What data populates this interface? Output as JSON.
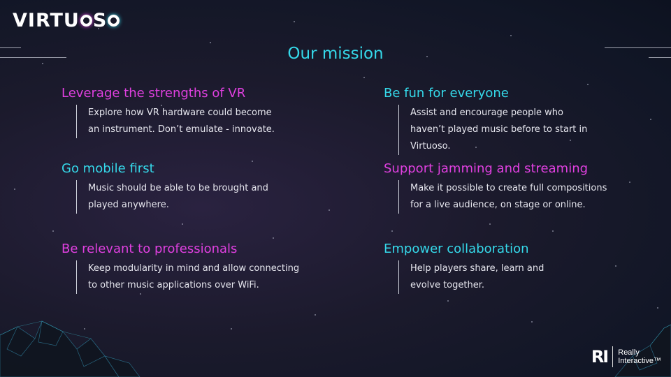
{
  "logo": {
    "part1": "VIRTU",
    "part2": "S",
    "ring1_color": "#e040e0",
    "ring2_color": "#35d9ea"
  },
  "title": "Our mission",
  "colors": {
    "pink": "#e040e0",
    "cyan": "#35d9ea"
  },
  "items": [
    {
      "heading": "Leverage the strengths of VR",
      "lines": [
        "Explore how VR hardware could become",
        "an instrument. Don’t emulate - innovate."
      ]
    },
    {
      "heading": "Be fun for everyone",
      "lines": [
        "Assist and encourage people who",
        "haven’t played music before to start in",
        "Virtuoso."
      ]
    },
    {
      "heading": "Go mobile first",
      "lines": [
        "Music should be able to be brought and",
        "played anywhere."
      ]
    },
    {
      "heading": "Support jamming and streaming",
      "lines": [
        "Make it possible to create full compositions",
        "for a live audience, on stage or online."
      ]
    },
    {
      "heading": "Be relevant to professionals",
      "lines": [
        "Keep modularity in mind and allow connecting",
        "to other music applications over WiFi."
      ]
    },
    {
      "heading": "Empower collaboration",
      "lines": [
        "Help players share, learn and",
        "evolve together."
      ]
    }
  ],
  "brand": {
    "mark": "RI",
    "line1": "Really",
    "line2": "Interactive™"
  }
}
